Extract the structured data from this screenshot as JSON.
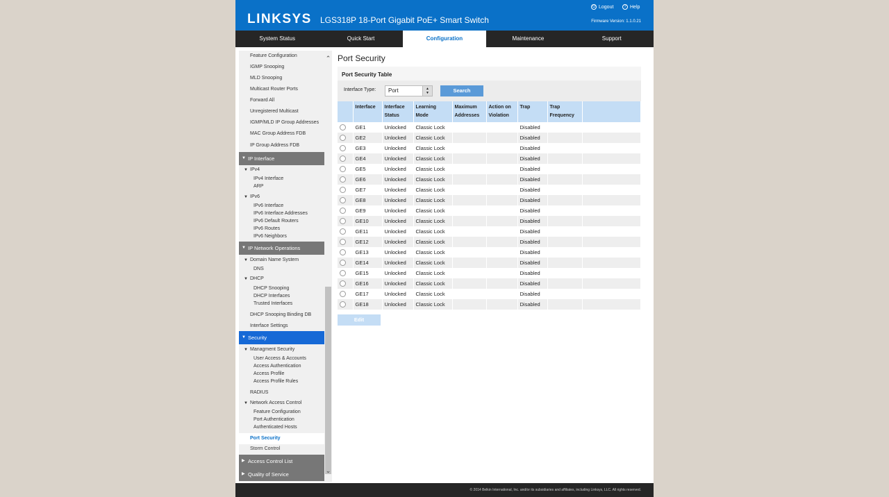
{
  "header": {
    "logo": "LINKSYS",
    "product": "LGS318P 18-Port Gigabit PoE+ Smart Switch",
    "logout": "Logout",
    "help": "Help",
    "firmware": "Firmware Version: 1.1.0.21"
  },
  "nav": [
    "System Status",
    "Quick Start",
    "Configuration",
    "Maintenance",
    "Support"
  ],
  "nav_active": "Configuration",
  "sidebar": {
    "items": [
      {
        "label": "Feature Configuration",
        "level": "l1"
      },
      {
        "label": "IGMP Snooping",
        "level": "l1"
      },
      {
        "label": "MLD Snooping",
        "level": "l1"
      },
      {
        "label": "Multicast Router Ports",
        "level": "l1"
      },
      {
        "label": "Forward All",
        "level": "l1"
      },
      {
        "label": "Unregistered Multicast",
        "level": "l1"
      },
      {
        "label": "IGMP/MLD IP Group Addresses",
        "level": "l1"
      },
      {
        "label": "MAC Group Address FDB",
        "level": "l1"
      },
      {
        "label": "IP Group Address FDB",
        "level": "l1"
      },
      {
        "label": "IP Interface",
        "level": "cat"
      },
      {
        "label": "IPv4",
        "level": "l2"
      },
      {
        "label": "IPv4 Interface",
        "level": "l3"
      },
      {
        "label": "ARP",
        "level": "l3"
      },
      {
        "label": "IPv6",
        "level": "l2"
      },
      {
        "label": "IPv6 Interface",
        "level": "l3"
      },
      {
        "label": "IPv6 Interface Addresses",
        "level": "l3"
      },
      {
        "label": "IPv6 Default Routers",
        "level": "l3"
      },
      {
        "label": "IPv6 Routes",
        "level": "l3"
      },
      {
        "label": "IPv6 Neighbors",
        "level": "l3"
      },
      {
        "label": "IP Network Operations",
        "level": "cat"
      },
      {
        "label": "Domain Name System",
        "level": "l2"
      },
      {
        "label": "DNS",
        "level": "l3"
      },
      {
        "label": "DHCP",
        "level": "l2"
      },
      {
        "label": "DHCP Snooping",
        "level": "l3"
      },
      {
        "label": "DHCP Interfaces",
        "level": "l3"
      },
      {
        "label": "Trusted Interfaces",
        "level": "l3"
      },
      {
        "label": "DHCP Snooping Binding DB",
        "level": "l1"
      },
      {
        "label": "Interface Settings",
        "level": "l1"
      },
      {
        "label": "Security",
        "level": "cat-blue"
      },
      {
        "label": "Managment Security",
        "level": "l2"
      },
      {
        "label": "User Access & Accounts",
        "level": "l3"
      },
      {
        "label": "Access Authentication",
        "level": "l3"
      },
      {
        "label": "Access Profile",
        "level": "l3"
      },
      {
        "label": "Access Profile Rules",
        "level": "l3"
      },
      {
        "label": "RADIUS",
        "level": "l1"
      },
      {
        "label": "Network Access Control",
        "level": "l2"
      },
      {
        "label": "Feature Configuration",
        "level": "l3"
      },
      {
        "label": "Port Authentication",
        "level": "l3"
      },
      {
        "label": "Authenticated Hosts",
        "level": "l3"
      },
      {
        "label": "Port Security",
        "level": "l1-sel"
      },
      {
        "label": "Storm Control",
        "level": "l1"
      },
      {
        "label": "Access Control List",
        "level": "cat-closed"
      },
      {
        "label": "Quality of Service",
        "level": "cat-closed"
      }
    ]
  },
  "main": {
    "title": "Port Security",
    "table_title": "Port Security Table",
    "filter_label": "Interface Type:",
    "filter_value": "Port",
    "search_label": "Search",
    "edit_label": "Edit",
    "columns": [
      "",
      "Interface",
      "Interface Status",
      "Learning Mode",
      "Maximum Addresses",
      "Action on Violation",
      "Trap",
      "Trap Frequency"
    ],
    "rows": [
      [
        "GE1",
        "Unlocked",
        "Classic Lock",
        "",
        "",
        "Disabled",
        ""
      ],
      [
        "GE2",
        "Unlocked",
        "Classic Lock",
        "",
        "",
        "Disabled",
        ""
      ],
      [
        "GE3",
        "Unlocked",
        "Classic Lock",
        "",
        "",
        "Disabled",
        ""
      ],
      [
        "GE4",
        "Unlocked",
        "Classic Lock",
        "",
        "",
        "Disabled",
        ""
      ],
      [
        "GE5",
        "Unlocked",
        "Classic Lock",
        "",
        "",
        "Disabled",
        ""
      ],
      [
        "GE6",
        "Unlocked",
        "Classic Lock",
        "",
        "",
        "Disabled",
        ""
      ],
      [
        "GE7",
        "Unlocked",
        "Classic Lock",
        "",
        "",
        "Disabled",
        ""
      ],
      [
        "GE8",
        "Unlocked",
        "Classic Lock",
        "",
        "",
        "Disabled",
        ""
      ],
      [
        "GE9",
        "Unlocked",
        "Classic Lock",
        "",
        "",
        "Disabled",
        ""
      ],
      [
        "GE10",
        "Unlocked",
        "Classic Lock",
        "",
        "",
        "Disabled",
        ""
      ],
      [
        "GE11",
        "Unlocked",
        "Classic Lock",
        "",
        "",
        "Disabled",
        ""
      ],
      [
        "GE12",
        "Unlocked",
        "Classic Lock",
        "",
        "",
        "Disabled",
        ""
      ],
      [
        "GE13",
        "Unlocked",
        "Classic Lock",
        "",
        "",
        "Disabled",
        ""
      ],
      [
        "GE14",
        "Unlocked",
        "Classic Lock",
        "",
        "",
        "Disabled",
        ""
      ],
      [
        "GE15",
        "Unlocked",
        "Classic Lock",
        "",
        "",
        "Disabled",
        ""
      ],
      [
        "GE16",
        "Unlocked",
        "Classic Lock",
        "",
        "",
        "Disabled",
        ""
      ],
      [
        "GE17",
        "Unlocked",
        "Classic Lock",
        "",
        "",
        "Disabled",
        ""
      ],
      [
        "GE18",
        "Unlocked",
        "Classic Lock",
        "",
        "",
        "Disabled",
        ""
      ]
    ]
  },
  "footer": "© 2014 Belkin International, Inc. and/or its subsidiaries and affiliates, including Linksys, LLC. All rights reserved.",
  "colors": {
    "brand": "#0a71c8",
    "nav": "#262626",
    "header_row": "#c4ddf5"
  }
}
